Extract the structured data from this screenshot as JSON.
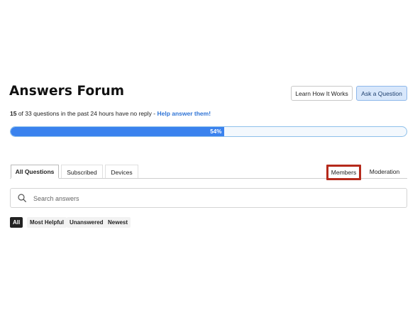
{
  "header": {
    "title": "Answers Forum",
    "learn_button": "Learn How It Works",
    "ask_button": "Ask a Question"
  },
  "stats": {
    "unanswered_count": "15",
    "text": " of 33 questions in the past 24 hours have no reply - ",
    "help_link": "Help answer them!"
  },
  "progress": {
    "percent": 54,
    "label": "54%"
  },
  "tabs": {
    "left": [
      "All Questions",
      "Subscribed",
      "Devices"
    ],
    "members": "Members",
    "moderation": "Moderation"
  },
  "search": {
    "placeholder": "Search answers",
    "icon": "search-icon"
  },
  "filters": [
    "All",
    "Most Helpful",
    "Unanswered",
    "Newest"
  ],
  "colors": {
    "accent": "#3a82ee",
    "highlight_box": "#b52a1c"
  }
}
